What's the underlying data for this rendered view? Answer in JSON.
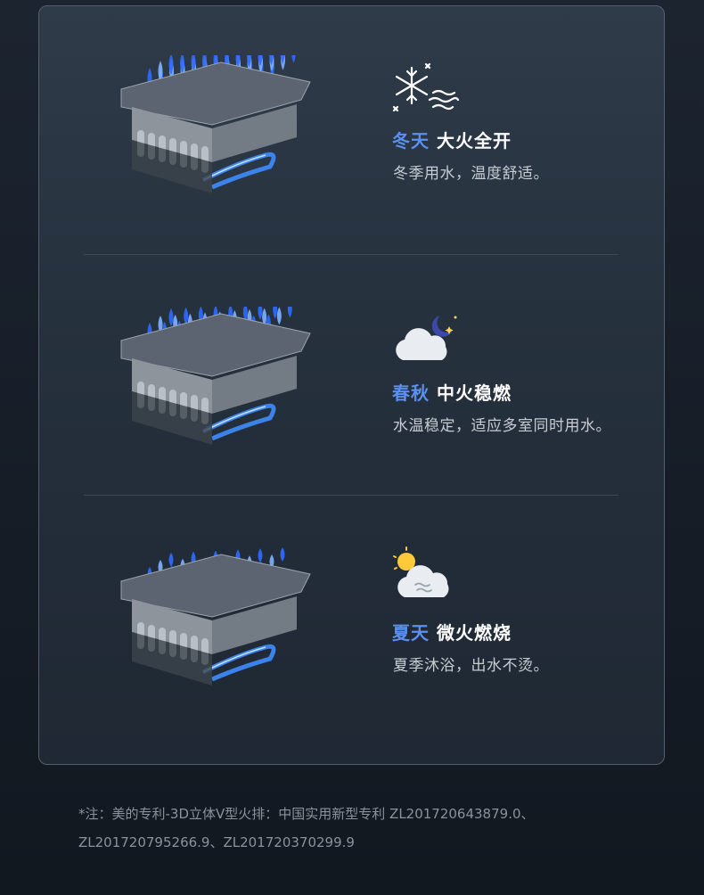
{
  "modes": [
    {
      "season": "冬天",
      "flame": "大火全开",
      "desc": "冬季用水，温度舒适。",
      "icon": "snowflake-wind-icon",
      "flame_count": 12
    },
    {
      "season": "春秋",
      "flame": "中火稳燃",
      "desc": "水温稳定，适应多室同时用水。",
      "icon": "cloud-moon-icon",
      "flame_count": 9
    },
    {
      "season": "夏天",
      "flame": "微火燃烧",
      "desc": "夏季沐浴，出水不烫。",
      "icon": "sun-cloud-icon",
      "flame_count": 6
    }
  ],
  "footnote": {
    "line1": "*注：美的专利-3D立体V型火排：中国实用新型专利 ZL201720643879.0、",
    "line2": "ZL201720795266.9、ZL201720370299.9"
  },
  "colors": {
    "season_blue": "#5b8ff0",
    "flame_blue": "#2f6bff",
    "panel_border": "#55606e"
  }
}
